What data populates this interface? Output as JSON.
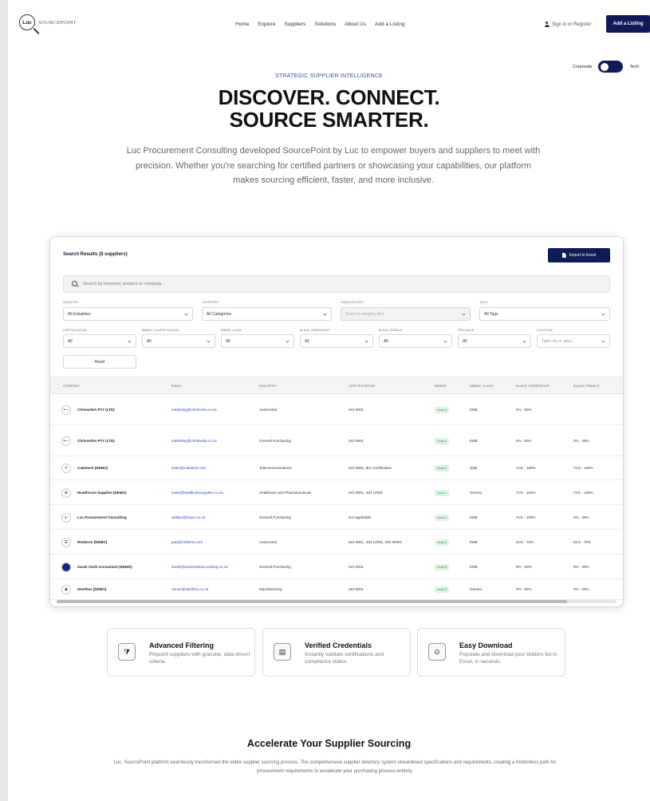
{
  "brand": {
    "logo_mark": "Luc",
    "logo_text": "SOURCEPOINT"
  },
  "nav": [
    "Home",
    "Explore",
    "Suppliers",
    "Solutions",
    "About Us",
    "Add a Listing"
  ],
  "header": {
    "signin": "Sign in or Register",
    "add_listing": "Add a Listing"
  },
  "mode_toggle": {
    "left": "Corporate",
    "right": "Tech",
    "state": "Corporate"
  },
  "hero": {
    "eyebrow": "STRATEGIC SUPPLIER INTELLIGENCE",
    "title_line1": "DISCOVER. CONNECT.",
    "title_line2": "SOURCE SMARTER.",
    "lede": "Luc Procurement Consulting developed SourcePoint by Luc to empower buyers and suppliers to meet with precision. Whether you're searching for certified partners or showcasing your capabilities, our platform makes sourcing efficient, faster, and more inclusive."
  },
  "results": {
    "title": "Search Results (8 suppliers)",
    "export_label": "Export to Excel",
    "search_placeholder": "Search by keyword, product or company...",
    "filters": {
      "industry": {
        "label": "INDUSTRY",
        "value": "All Industries"
      },
      "category": {
        "label": "CATEGORY",
        "value": "All Categories"
      },
      "subcategory": {
        "label": "SUBCATEGORY",
        "value": "Select a category first"
      },
      "tags": {
        "label": "TAGS",
        "value": "All Tags"
      },
      "certification": {
        "label": "CERTIFICATION",
        "value": "All"
      },
      "bbbee_class": {
        "label": "BBBEE CLASSIFICATION",
        "value": "All"
      },
      "bbbee_level": {
        "label": "BBBEE LEVEL",
        "value": "All"
      },
      "black_ownership": {
        "label": "BLACK OWNERSHIP",
        "value": "All"
      },
      "black_female": {
        "label": "BLACK FEMALE",
        "value": "All"
      },
      "province": {
        "label": "PROVINCE",
        "value": "All"
      },
      "location": {
        "label": "LOCATION",
        "placeholder": "Type city or area..."
      }
    },
    "reset_label": "Reset",
    "columns": [
      "COMPANY",
      "EMAIL",
      "INDUSTRY",
      "CERTIFICATION",
      "BBBEE",
      "BBBEE CLASS.",
      "BLACK OWNERSHIP",
      "BLACK FEMALE"
    ],
    "rows": [
      {
        "avatar": "•—",
        "company": "ChrisnelSA PTY (LTD)",
        "email": "marketing@chrisnelsa.co.za",
        "industry": "Automotive",
        "certification": "ISO 9001",
        "bbbee": "Level 4",
        "class": "EME",
        "ownership": "0% - 50%",
        "female": ""
      },
      {
        "avatar": "•—",
        "company": "ChrisnelSA PTY (LTD)",
        "email": "marketing@chrisnelsa.co.za",
        "industry": "General Purchasing",
        "certification": "ISO 9001",
        "bbbee": "Level 4",
        "class": "EME",
        "ownership": "0% - 50%",
        "female": "0% - 29%"
      },
      {
        "avatar": "⚘",
        "company": "Cubetech (DEMO)",
        "email": "sales@cubetech.com",
        "industry": "Telecommunications",
        "certification": "ISO 9001, IEC Certification",
        "bbbee": "Level 2",
        "class": "QSE",
        "ownership": "71% - 100%",
        "female": "71% - 100%"
      },
      {
        "avatar": "⊕",
        "company": "HealthCare Supplies (DEMO)",
        "email": "sales@healthcaresupplies.co.za",
        "industry": "Healthcare and Pharmaceuticals",
        "certification": "ISO 9001, ISO 14001",
        "bbbee": "Level 1",
        "class": "Generic",
        "ownership": "71% - 100%",
        "female": "71% - 100%"
      },
      {
        "avatar": "-L-",
        "company": "Luc Procurement Consulting",
        "email": "wallace@lucpc.co.za",
        "industry": "General Purchasing",
        "certification": "Not applicable",
        "bbbee": "Level 1",
        "class": "EME",
        "ownership": "71% - 100%",
        "female": "0% - 29%"
      },
      {
        "avatar": "☰",
        "company": "Rimberio (DEMO)",
        "email": "paul@rimberio.com",
        "industry": "Automotive",
        "certification": "ISO 9001, ISO 14001, ISO 50001",
        "bbbee": "Level 2",
        "class": "EME",
        "ownership": "51% - 70%",
        "female": "51% - 70%"
      },
      {
        "avatar": "●",
        "company": "Sarah Clark Accountant (DEMO)",
        "email": "sarah@sarahclarkaccounting.co.za",
        "industry": "General Purchasing",
        "certification": "ISO 9001",
        "bbbee": "Level 6",
        "class": "EME",
        "ownership": "0% - 50%",
        "female": "0% - 29%"
      },
      {
        "avatar": "♟",
        "company": "Steelhex (DEMO)",
        "email": "Simon@steelhex.co.za",
        "industry": "Manufacturing",
        "certification": "ISO 9001",
        "bbbee": "Level 2",
        "class": "Generic",
        "ownership": "0% - 50%",
        "female": "0% - 29%"
      }
    ]
  },
  "features": [
    {
      "icon": "filter-icon",
      "glyph": "⧩",
      "title": "Advanced Filtering",
      "desc": "Pinpoint suppliers with granular, data-driven criteria."
    },
    {
      "icon": "document-check-icon",
      "glyph": "▤",
      "title": "Verified Credentials",
      "desc": "Instantly validate certifications and compliance status."
    },
    {
      "icon": "download-icon",
      "glyph": "⊙",
      "title": "Easy Download",
      "desc": "Populate and download your bidders list in Excel, in seconds."
    }
  ],
  "accelerate": {
    "title": "Accelerate Your Supplier Sourcing",
    "body": "Luc. SourcePoint platform seamlessly transformed the entire supplier sourcing process. The comprehensive supplier directory system streamlined specifications and requirements, creating a frictionless path for procurement requirements to accelerate your purchasing process entirely."
  },
  "colors": {
    "brand_navy": "#101a55",
    "accent_blue": "#3346b8",
    "badge_green": "#2d8a43"
  }
}
